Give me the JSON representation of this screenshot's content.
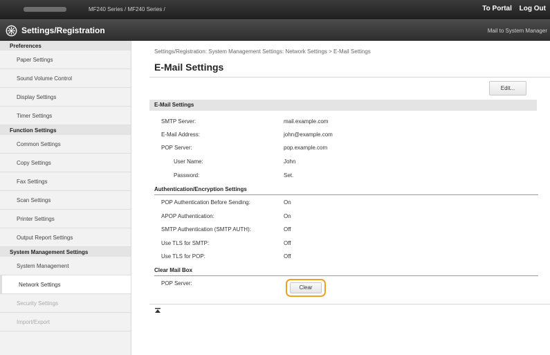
{
  "topbar": {
    "device": "MF240 Series / MF240 Series /",
    "portal_link": "To Portal",
    "logout_link": "Log Out"
  },
  "appbar": {
    "title": "Settings/Registration",
    "mail_link": "Mail to System Manager"
  },
  "sidebar": {
    "groups": [
      {
        "header": "Preferences",
        "items": [
          "Paper Settings",
          "Sound Volume Control",
          "Display Settings",
          "Timer Settings"
        ]
      },
      {
        "header": "Function Settings",
        "items": [
          "Common Settings",
          "Copy Settings",
          "Fax Settings",
          "Scan Settings",
          "Printer Settings",
          "Output Report Settings"
        ]
      },
      {
        "header": "System Management Settings",
        "items": [
          "System Management",
          "Network Settings",
          "Security Settings",
          "Import/Export"
        ]
      }
    ],
    "active_item": "Network Settings"
  },
  "main": {
    "breadcrumb": "Settings/Registration: System Management Settings: Network Settings > E-Mail Settings",
    "title": "E-Mail Settings",
    "edit_label": "Edit...",
    "section_title": "E-Mail Settings",
    "rows": [
      {
        "label": "SMTP Server:",
        "value": "mail.example.com"
      },
      {
        "label": "E-Mail Address:",
        "value": "john@example.com"
      },
      {
        "label": "POP Server:",
        "value": "pop.example.com"
      },
      {
        "label": "User Name:",
        "value": "John"
      },
      {
        "label": "Password:",
        "value": "Set."
      }
    ],
    "auth_header": "Authentication/Encryption Settings",
    "auth_rows": [
      {
        "label": "POP Authentication Before Sending:",
        "value": "On"
      },
      {
        "label": "APOP Authentication:",
        "value": "On"
      },
      {
        "label": "SMTP Authentication (SMTP AUTH):",
        "value": "Off"
      },
      {
        "label": "Use TLS for SMTP:",
        "value": "Off"
      },
      {
        "label": "Use TLS for POP:",
        "value": "Off"
      }
    ],
    "clear_header": "Clear Mail Box",
    "clear_label": "POP Server:",
    "clear_button": "Clear"
  }
}
